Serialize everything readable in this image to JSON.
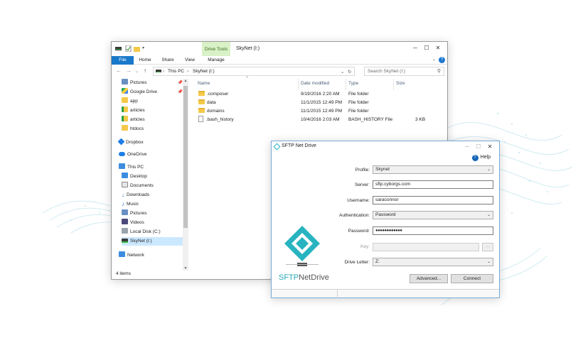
{
  "explorer": {
    "title": "SkyNet (I:)",
    "context_tab": "Drive Tools",
    "ribbon_tabs": [
      "File",
      "Home",
      "Share",
      "View",
      "Manage"
    ],
    "breadcrumb": [
      "This PC",
      "SkyNet (I:)"
    ],
    "search_placeholder": "Search SkyNet (I:)",
    "nav": {
      "quick_access": [
        {
          "label": "Pictures",
          "icon": "pictures-icon",
          "pinned": true
        },
        {
          "label": "Google Drive",
          "icon": "google-drive-icon",
          "pinned": true
        },
        {
          "label": "app",
          "icon": "folder-icon"
        },
        {
          "label": "articles",
          "icon": "folder-icon"
        },
        {
          "label": "articles",
          "icon": "folder-icon"
        },
        {
          "label": "htdocs",
          "icon": "folder-icon"
        }
      ],
      "dropbox": "Dropbox",
      "onedrive": "OneDrive",
      "this_pc": "This PC",
      "pc_items": [
        {
          "label": "Desktop",
          "icon": "desktop-icon"
        },
        {
          "label": "Documents",
          "icon": "documents-icon"
        },
        {
          "label": "Downloads",
          "icon": "downloads-icon"
        },
        {
          "label": "Music",
          "icon": "music-icon"
        },
        {
          "label": "Pictures",
          "icon": "pictures-icon"
        },
        {
          "label": "Videos",
          "icon": "videos-icon"
        },
        {
          "label": "Local Disk (C:)",
          "icon": "local-disk-icon"
        },
        {
          "label": "SkyNet (I:)",
          "icon": "network-drive-icon",
          "selected": true
        }
      ],
      "network": "Network"
    },
    "columns": {
      "name": "Name",
      "date": "Date modified",
      "type": "Type",
      "size": "Size"
    },
    "files": [
      {
        "name": ".composer",
        "date": "9/19/2016 2:20 AM",
        "type": "File folder",
        "size": "",
        "kind": "folder"
      },
      {
        "name": "data",
        "date": "11/1/2015 12:49 PM",
        "type": "File folder",
        "size": "",
        "kind": "folder"
      },
      {
        "name": "domains",
        "date": "11/1/2015 12:49 PM",
        "type": "File folder",
        "size": "",
        "kind": "folder"
      },
      {
        "name": ".bash_history",
        "date": "10/4/2016 2:03 AM",
        "type": "BASH_HISTORY File",
        "size": "3 KB",
        "kind": "file"
      }
    ],
    "status": "4 items"
  },
  "sftp": {
    "title": "SFTP Net Drive",
    "help": "Help",
    "profile": {
      "label": "Profile:",
      "value": "Skynet"
    },
    "server": {
      "label": "Server:",
      "value": "sftp.cyborgs.com"
    },
    "username": {
      "label": "Username:",
      "value": "saraconnor"
    },
    "authentication": {
      "label": "Authentication:",
      "value": "Password"
    },
    "password": {
      "label": "Password:",
      "value": "●●●●●●●●●●●●"
    },
    "key": {
      "label": "Key:",
      "value": ""
    },
    "drive_letter": {
      "label": "Drive Letter:",
      "value": "Z:"
    },
    "advanced_button": "Advanced...",
    "connect_button": "Connect",
    "brand_sftp": "SFTP",
    "brand_rest": "NetDrive",
    "browse_button": "..."
  },
  "colors": {
    "accent": "#1979ca",
    "teal": "#27b4c0",
    "context_tab": "#d8f1c6",
    "selection": "#cce8ff"
  }
}
